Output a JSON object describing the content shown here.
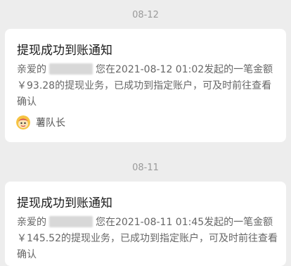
{
  "messages": [
    {
      "date": "08-12",
      "title": "提现成功到账通知",
      "prefix": "亲爱的",
      "body": "您在2021-08-12 01:02发起的一笔金额￥93.28的提现业务，已成功到指定账户，可及时前往查看确认",
      "source": "薯队长",
      "source_icon": "shu-captain-avatar-icon"
    },
    {
      "date": "08-11",
      "title": "提现成功到账通知",
      "prefix": "亲爱的",
      "body": "您在2021-08-11 01:45发起的一笔金额￥145.52的提现业务，已成功到指定账户，可及时前往查看确认"
    }
  ]
}
